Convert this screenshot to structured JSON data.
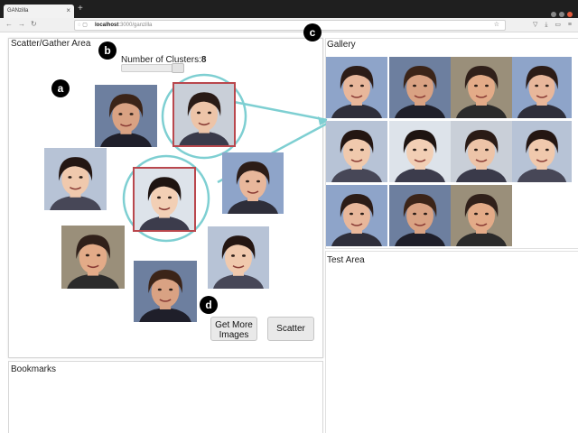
{
  "browser": {
    "tab_title": "GANzilla",
    "tab_close": "×",
    "new_tab": "+",
    "url_host": "localhost",
    "url_path": ":3000/ganzilla"
  },
  "scatter": {
    "title": "Scatter/Gather Area",
    "cluster_label": "Number of Clusters:",
    "cluster_value": "8",
    "get_more_line1": "Get More",
    "get_more_line2": "Images",
    "scatter_button": "Scatter"
  },
  "bookmarks": {
    "title": "Bookmarks"
  },
  "gallery": {
    "title": "Gallery"
  },
  "test": {
    "title": "Test Area"
  },
  "markers": {
    "a": "a",
    "b": "b",
    "c": "c",
    "d": "d"
  },
  "colors": {
    "selection": "#b9474d",
    "callout": "#7ecfd2"
  },
  "icons": [
    "back-arrow-icon",
    "forward-arrow-icon",
    "reload-icon",
    "shield-icon",
    "page-icon",
    "bookmark-star-icon"
  ]
}
